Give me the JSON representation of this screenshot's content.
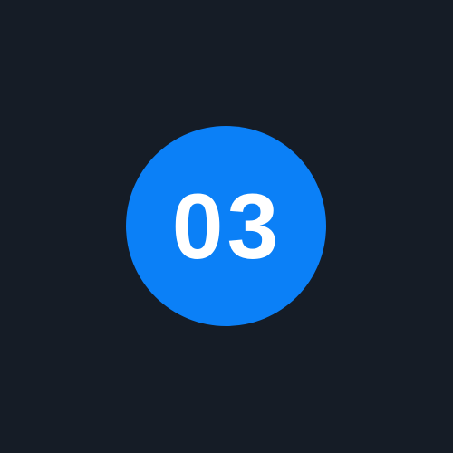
{
  "badge": {
    "number": "03",
    "background_color": "#0b80f7",
    "text_color": "#ffffff"
  },
  "page": {
    "background_color": "#151c26"
  }
}
